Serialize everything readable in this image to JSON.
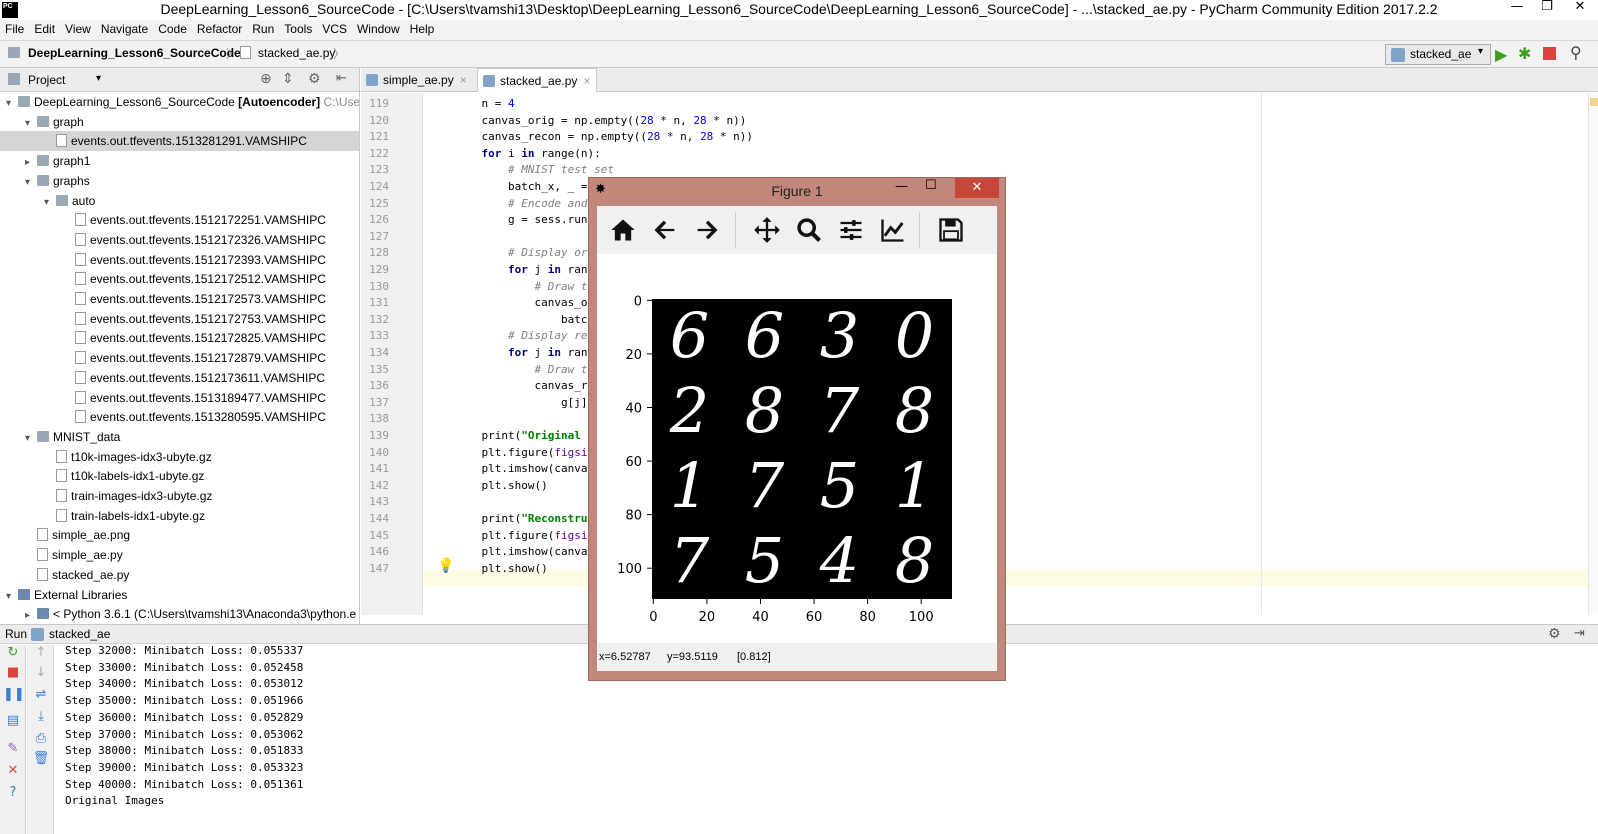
{
  "window": {
    "title": "DeepLearning_Lesson6_SourceCode - [C:\\Users\\tvamshi13\\Desktop\\DeepLearning_Lesson6_SourceCode\\DeepLearning_Lesson6_SourceCode] - ...\\stacked_ae.py - PyCharm Community Edition 2017.2.2",
    "logo": "PC"
  },
  "menu": [
    "File",
    "Edit",
    "View",
    "Navigate",
    "Code",
    "Refactor",
    "Run",
    "Tools",
    "VCS",
    "Window",
    "Help"
  ],
  "breadcrumb": {
    "project": "DeepLearning_Lesson6_SourceCode",
    "file": "stacked_ae.py"
  },
  "run_config": {
    "name": "stacked_ae"
  },
  "project_panel": {
    "header": "Project",
    "items": [
      {
        "label": "DeepLearning_Lesson6_SourceCode",
        "bold_suffix": "[Autoencoder]",
        "hint": "C:\\Users\\",
        "kind": "folder",
        "depth": 0,
        "arrow": "▾"
      },
      {
        "label": "graph",
        "kind": "folder",
        "depth": 1,
        "arrow": "▾"
      },
      {
        "label": "events.out.tfevents.1513281291.VAMSHIPC",
        "kind": "file",
        "depth": 2,
        "arrow": "",
        "selected": true
      },
      {
        "label": "graph1",
        "kind": "folder",
        "depth": 1,
        "arrow": "▸"
      },
      {
        "label": "graphs",
        "kind": "folder",
        "depth": 1,
        "arrow": "▾"
      },
      {
        "label": "auto",
        "kind": "folder",
        "depth": 2,
        "arrow": "▾"
      },
      {
        "label": "events.out.tfevents.1512172251.VAMSHIPC",
        "kind": "file",
        "depth": 3,
        "arrow": ""
      },
      {
        "label": "events.out.tfevents.1512172326.VAMSHIPC",
        "kind": "file",
        "depth": 3,
        "arrow": ""
      },
      {
        "label": "events.out.tfevents.1512172393.VAMSHIPC",
        "kind": "file",
        "depth": 3,
        "arrow": ""
      },
      {
        "label": "events.out.tfevents.1512172512.VAMSHIPC",
        "kind": "file",
        "depth": 3,
        "arrow": ""
      },
      {
        "label": "events.out.tfevents.1512172573.VAMSHIPC",
        "kind": "file",
        "depth": 3,
        "arrow": ""
      },
      {
        "label": "events.out.tfevents.1512172753.VAMSHIPC",
        "kind": "file",
        "depth": 3,
        "arrow": ""
      },
      {
        "label": "events.out.tfevents.1512172825.VAMSHIPC",
        "kind": "file",
        "depth": 3,
        "arrow": ""
      },
      {
        "label": "events.out.tfevents.1512172879.VAMSHIPC",
        "kind": "file",
        "depth": 3,
        "arrow": ""
      },
      {
        "label": "events.out.tfevents.1512173611.VAMSHIPC",
        "kind": "file",
        "depth": 3,
        "arrow": ""
      },
      {
        "label": "events.out.tfevents.1513189477.VAMSHIPC",
        "kind": "file",
        "depth": 3,
        "arrow": ""
      },
      {
        "label": "events.out.tfevents.1513280595.VAMSHIPC",
        "kind": "file",
        "depth": 3,
        "arrow": ""
      },
      {
        "label": "MNIST_data",
        "kind": "folder",
        "depth": 1,
        "arrow": "▾"
      },
      {
        "label": "t10k-images-idx3-ubyte.gz",
        "kind": "file",
        "depth": 2,
        "arrow": ""
      },
      {
        "label": "t10k-labels-idx1-ubyte.gz",
        "kind": "file",
        "depth": 2,
        "arrow": ""
      },
      {
        "label": "train-images-idx3-ubyte.gz",
        "kind": "file",
        "depth": 2,
        "arrow": ""
      },
      {
        "label": "train-labels-idx1-ubyte.gz",
        "kind": "file",
        "depth": 2,
        "arrow": ""
      },
      {
        "label": "simple_ae.png",
        "kind": "file",
        "depth": 1,
        "arrow": ""
      },
      {
        "label": "simple_ae.py",
        "kind": "file",
        "depth": 1,
        "arrow": ""
      },
      {
        "label": "stacked_ae.py",
        "kind": "file",
        "depth": 1,
        "arrow": ""
      },
      {
        "label": "External Libraries",
        "kind": "lib",
        "depth": 0,
        "arrow": "▾"
      },
      {
        "label": "< Python 3.6.1 (C:\\Users\\tvamshi13\\Anaconda3\\python.e",
        "kind": "lib",
        "depth": 1,
        "arrow": "▸"
      }
    ]
  },
  "tabs": [
    {
      "label": "simple_ae.py",
      "active": false
    },
    {
      "label": "stacked_ae.py",
      "active": true
    }
  ],
  "code_lines": [
    {
      "n": "119",
      "html": "    n = <span class=\"num\">4</span>"
    },
    {
      "n": "120",
      "html": "    canvas_orig = np.empty((<span class=\"num\">28</span> * n, <span class=\"num\">28</span> * n))"
    },
    {
      "n": "121",
      "html": "    canvas_recon = np.empty((<span class=\"num\">28</span> * n, <span class=\"num\">28</span> * n))"
    },
    {
      "n": "122",
      "html": "    <span class=\"kw\">for</span> i <span class=\"kw\">in</span> range(n):"
    },
    {
      "n": "123",
      "html": "        <span class=\"cm\"># MNIST test set</span>"
    },
    {
      "n": "124",
      "html": "        batch_x, _ = mn"
    },
    {
      "n": "125",
      "html": "        <span class=\"cm\"># Encode and de</span>"
    },
    {
      "n": "126",
      "html": "        g = sess.run(de"
    },
    {
      "n": "127",
      "html": ""
    },
    {
      "n": "128",
      "html": "        <span class=\"cm\"># Display origi</span>"
    },
    {
      "n": "129",
      "html": "        <span class=\"kw\">for</span> j <span class=\"kw\">in</span> range("
    },
    {
      "n": "130",
      "html": "            <span class=\"cm\"># Draw the</span>"
    },
    {
      "n": "131",
      "html": "            canvas_orig"
    },
    {
      "n": "132",
      "html": "                batch_x"
    },
    {
      "n": "133",
      "html": "        <span class=\"cm\"># Display recon</span>"
    },
    {
      "n": "134",
      "html": "        <span class=\"kw\">for</span> j <span class=\"kw\">in</span> range("
    },
    {
      "n": "135",
      "html": "            <span class=\"cm\"># Draw the</span>"
    },
    {
      "n": "136",
      "html": "            canvas_reco"
    },
    {
      "n": "137",
      "html": "                g[j].re"
    },
    {
      "n": "138",
      "html": ""
    },
    {
      "n": "139",
      "html": "    print(<span class=\"str\">\"Original Ima</span>"
    },
    {
      "n": "140",
      "html": "    plt.figure(<span class=\"kwarg\">figsize</span>="
    },
    {
      "n": "141",
      "html": "    plt.imshow(canvas_o"
    },
    {
      "n": "142",
      "html": "    plt.show()"
    },
    {
      "n": "143",
      "html": ""
    },
    {
      "n": "144",
      "html": "    print(<span class=\"str\">\"Reconstructe</span>"
    },
    {
      "n": "145",
      "html": "    plt.figure(<span class=\"kwarg\">figsize</span>="
    },
    {
      "n": "146",
      "html": "    plt.imshow(canvas_r"
    },
    {
      "n": "147",
      "html": "    plt.show()"
    }
  ],
  "run_panel": {
    "label": "Run",
    "config": "stacked_ae",
    "lines": [
      "Step 32000: Minibatch Loss: 0.055337",
      "Step 33000: Minibatch Loss: 0.052458",
      "Step 34000: Minibatch Loss: 0.053012",
      "Step 35000: Minibatch Loss: 0.051966",
      "Step 36000: Minibatch Loss: 0.052829",
      "Step 37000: Minibatch Loss: 0.053062",
      "Step 38000: Minibatch Loss: 0.051833",
      "Step 39000: Minibatch Loss: 0.053323",
      "Step 40000: Minibatch Loss: 0.051361",
      "Original Images"
    ]
  },
  "figure": {
    "title": "Figure 1",
    "status": {
      "x": "x=6.52787",
      "y": "y=93.5119",
      "value": "[0.812]"
    },
    "x_ticks": [
      "0",
      "20",
      "40",
      "60",
      "80",
      "100"
    ],
    "y_ticks": [
      "0",
      "20",
      "40",
      "60",
      "80",
      "100"
    ],
    "digits": [
      "6",
      "6",
      "3",
      "0",
      "2",
      "8",
      "7",
      "8",
      "1",
      "7",
      "5",
      "1",
      "7",
      "5",
      "4",
      "8"
    ]
  }
}
